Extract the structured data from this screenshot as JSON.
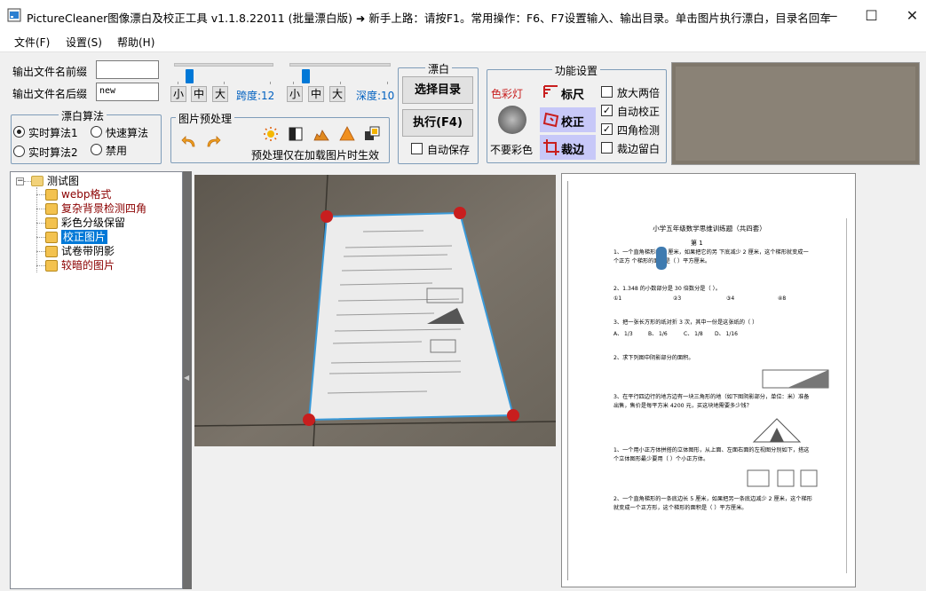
{
  "window": {
    "title": "PictureCleaner图像漂白及校正工具 v1.1.8.22011 (批量漂白版)  ➜ 新手上路：请按F1。常用操作：F6、F7设置输入、输出目录。单击图片执行漂白，目录名回车...",
    "minimize": "—",
    "maximize": "☐",
    "close": "✕"
  },
  "menu": [
    "文件(F)",
    "设置(S)",
    "帮助(H)"
  ],
  "output": {
    "prefix_label": "输出文件名前缀",
    "prefix_value": "",
    "suffix_label": "输出文件名后缀",
    "suffix_value": "new"
  },
  "sliders": {
    "left_buttons": [
      "小",
      "中",
      "大"
    ],
    "left_label": "跨度:12",
    "left_level": 0.12,
    "right_buttons": [
      "小",
      "中",
      "大"
    ],
    "right_label": "深度:10",
    "right_level": 0.12
  },
  "algo": {
    "title": "漂白算法",
    "options": [
      {
        "label": "实时算法1",
        "selected": true
      },
      {
        "label": "快速算法",
        "selected": false
      },
      {
        "label": "实时算法2",
        "selected": false
      },
      {
        "label": "禁用",
        "selected": false
      }
    ]
  },
  "preprocess": {
    "title": "图片预处理",
    "note": "预处理仅在加载图片时生效"
  },
  "bleach": {
    "title": "漂白",
    "select_dir": "选择目录",
    "execute": "执行(F4)",
    "auto_save": "自动保存",
    "auto_save_checked": false
  },
  "functions": {
    "title": "功能设置",
    "color_lamp": "色彩灯",
    "no_color": "不要彩色",
    "ruler": "标尺",
    "correct": "校正",
    "crop": "裁边",
    "checks": [
      {
        "label": "放大两倍",
        "checked": false
      },
      {
        "label": "自动校正",
        "checked": true
      },
      {
        "label": "四角检测",
        "checked": true
      },
      {
        "label": "裁边留白",
        "checked": false
      }
    ]
  },
  "tree": {
    "root": "测试图",
    "items": [
      {
        "label": "webp格式",
        "color": "#8b0000",
        "selected": false
      },
      {
        "label": "复杂背景检测四角",
        "color": "#8b0000",
        "selected": false
      },
      {
        "label": "彩色分级保留",
        "color": "#000000",
        "selected": false
      },
      {
        "label": "校正图片",
        "color": "#ffffff",
        "selected": true
      },
      {
        "label": "试卷带阴影",
        "color": "#000000",
        "selected": false
      },
      {
        "label": "较暗的图片",
        "color": "#8b0000",
        "selected": false
      }
    ]
  },
  "document": {
    "title": "小学五年级数学思维训练题（共四套）",
    "section": "第 1",
    "questions": [
      "1、一个直角梯形的     5 厘米，如果把它的另     下底减少  2 厘米，这个梯形就变成一个正方     个梯形的面积是（     ）平方厘米。",
      "2、1.348 的小数部分是  30 倍数分是（     ）。",
      "3、把一张长方形的纸对折  3 次，其中一份是这张纸的（     ）",
      "2、求下列图中阴影部分的面积。",
      "3、在平行四边行的地方边有一块三角形的地（如下图阴影部分，单位：米）准备出售，售价是每平方米    4200 元，买这块地需要多少钱？",
      "1、一个用小正方体拼搭的立体图形，从上面、左面右面的左视图分别如下，搭这个立体图形最少要用（    ）个小正方体。",
      "2、一个直角梯形的一条底边长    5 厘米，如果把另一条底边减少   2 厘米，这个梯形就变成一个正方形，这个梯形的面积是（    ）平方厘米。"
    ],
    "options": [
      "①1",
      "②3",
      "③4",
      "④8"
    ],
    "fraction_choices": [
      "A、 1/3",
      "B、 1/6",
      "C、 1/8",
      "D、 1/16"
    ]
  },
  "colors": {
    "accent": "#0078d7",
    "tree_selected_bg": "#0078d7",
    "corner_marker": "#c81e1e",
    "quad_outline": "#3a9ad9",
    "func_highlight": "#c7c8f8"
  }
}
